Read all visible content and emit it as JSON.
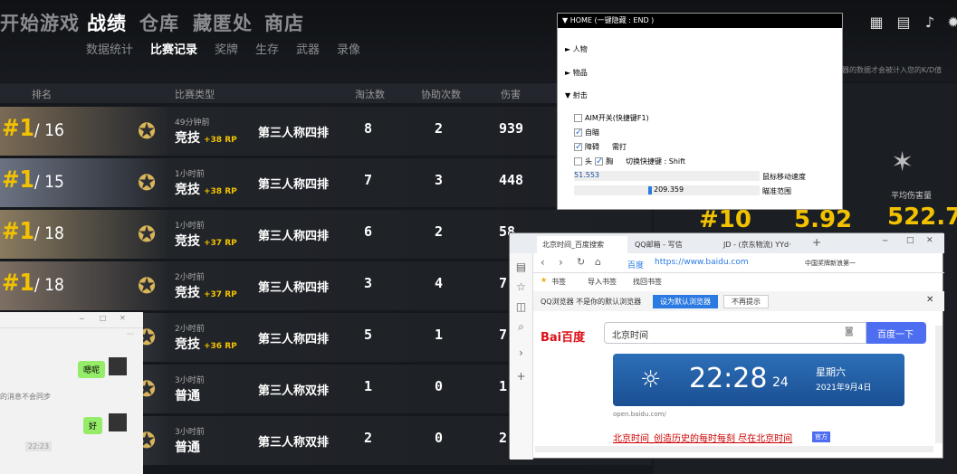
{
  "nav": {
    "main": [
      "开始游戏",
      "战绩",
      "仓库",
      "藏匿处",
      "商店"
    ],
    "sub": [
      "数据统计",
      "比赛记录",
      "奖牌",
      "生存",
      "武器",
      "录像"
    ]
  },
  "table": {
    "headers": [
      "排名",
      "比赛类型",
      "淘汰数",
      "协助次数",
      "伤害"
    ],
    "rows": [
      {
        "rank": "#1",
        "total": "/ 16",
        "time": "49分钟前",
        "mode": "竞技",
        "rp": "+38 RP",
        "squad": "第三人称四排",
        "kills": "8",
        "assists": "2",
        "damage": "939"
      },
      {
        "rank": "#1",
        "total": "/ 15",
        "time": "1小时前",
        "mode": "竞技",
        "rp": "+38 RP",
        "squad": "第三人称四排",
        "kills": "7",
        "assists": "3",
        "damage": "448"
      },
      {
        "rank": "#1",
        "total": "/ 18",
        "time": "1小时前",
        "mode": "竞技",
        "rp": "+37 RP",
        "squad": "第三人称四排",
        "kills": "6",
        "assists": "2",
        "damage": "58"
      },
      {
        "rank": "#1",
        "total": "/ 18",
        "time": "2小时前",
        "mode": "竞技",
        "rp": "+37 RP",
        "squad": "第三人称四排",
        "kills": "3",
        "assists": "4",
        "damage": "7"
      },
      {
        "rank": "",
        "total": "",
        "time": "2小时前",
        "mode": "竞技",
        "rp": "+36 RP",
        "squad": "第三人称四排",
        "kills": "5",
        "assists": "1",
        "damage": "7"
      },
      {
        "rank": "",
        "total": "",
        "time": "3小时前",
        "mode": "普通",
        "rp": "",
        "squad": "第三人称双排",
        "kills": "1",
        "assists": "0",
        "damage": "1"
      },
      {
        "rank": "",
        "total": "",
        "time": "3小时前",
        "mode": "普通",
        "rp": "",
        "squad": "第三人称双排",
        "kills": "2",
        "assists": "0",
        "damage": "2"
      }
    ]
  },
  "right": {
    "note": "器的数据才会被计入您的K/D值",
    "avg_label": "平均伤害量",
    "avg_value": "522.7",
    "stat1": "#10",
    "stat2": "5.92"
  },
  "cheat": {
    "title": "▼ HOME (一键隐藏 : END )",
    "items": [
      "► 人物",
      "► 物品",
      "▼ 射击"
    ],
    "aim": "AIM开关(快捷键F1)",
    "auto": "自瞄",
    "barrier": "障碍",
    "shoot": "需打",
    "head": "头",
    "chest": "胸",
    "switch": "切换快捷键 : Shift",
    "v1": "51.553",
    "v1_label": "鼠标移动速度",
    "v2": "209.359",
    "v2_label": "瞄准范围"
  },
  "chat": {
    "msg1": "嗯呢",
    "msg2": "好",
    "note": "的消息不会同步",
    "time": "22:23"
  },
  "browser": {
    "tabs": [
      "北京时间_百度搜索",
      "QQ邮箱 - 写信",
      "JD - (京东物流) YYd·"
    ],
    "url": "https://www.baidu.com",
    "url_tag": "百度",
    "bookmarks": [
      "书签",
      "导入书签",
      "找回书签"
    ],
    "info": "QQ浏览器 不是你的默认浏览器",
    "set_default": "设为默认浏览器",
    "no_prompt": "不再提示",
    "search_value": "北京时间",
    "search_btn": "百度一下",
    "logo": "Bai百度",
    "clock": "22:28",
    "sec": "24",
    "weekday": "星期六",
    "date": "2021年9月4日",
    "src": "open.baidu.com/",
    "result": "北京时间_创造历史的每时每刻 尽在北京时间",
    "official": "官方",
    "news": "中国奖牌新浪第一"
  }
}
